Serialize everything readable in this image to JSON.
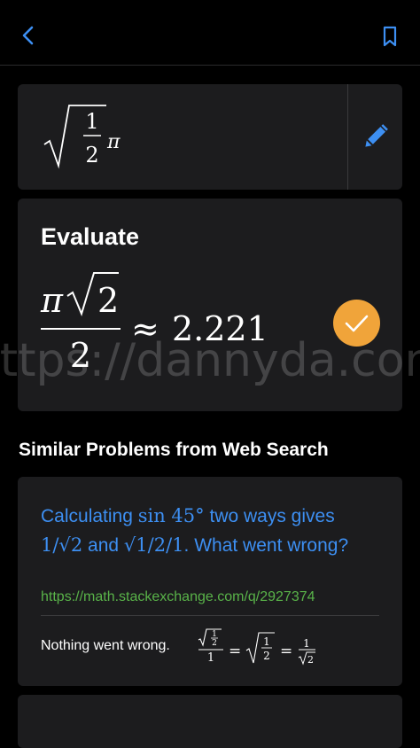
{
  "header": {
    "back_icon": "chevron-left-icon",
    "bookmark_icon": "bookmark-icon",
    "accent_color": "#3d8ff2"
  },
  "input": {
    "expression": "√(1/2) π",
    "frac_num": "1",
    "frac_den": "2",
    "pi": "π",
    "edit_icon": "pencil-icon"
  },
  "result": {
    "title": "Evaluate",
    "numerator": "π√2",
    "pi": "π",
    "radicand": "2",
    "denominator": "2",
    "approx": "≈",
    "value": "2.221",
    "check_icon": "checkmark-icon",
    "check_color": "#f0a43a"
  },
  "similar": {
    "section_title": "Similar Problems from Web Search",
    "items": [
      {
        "title_part1": "Calculating ",
        "title_math1": "sin 45°",
        "title_part2": " two ways gives",
        "title_math2": "1/√2",
        "title_part3": " and ",
        "title_math3": "√1/2/1",
        "title_part4": ". What went wrong?",
        "url": "https://math.stackexchange.com/q/2927374",
        "snippet_text": "Nothing went wrong.",
        "url_color": "#59b349"
      }
    ]
  },
  "watermark": "https://dannyda.com"
}
